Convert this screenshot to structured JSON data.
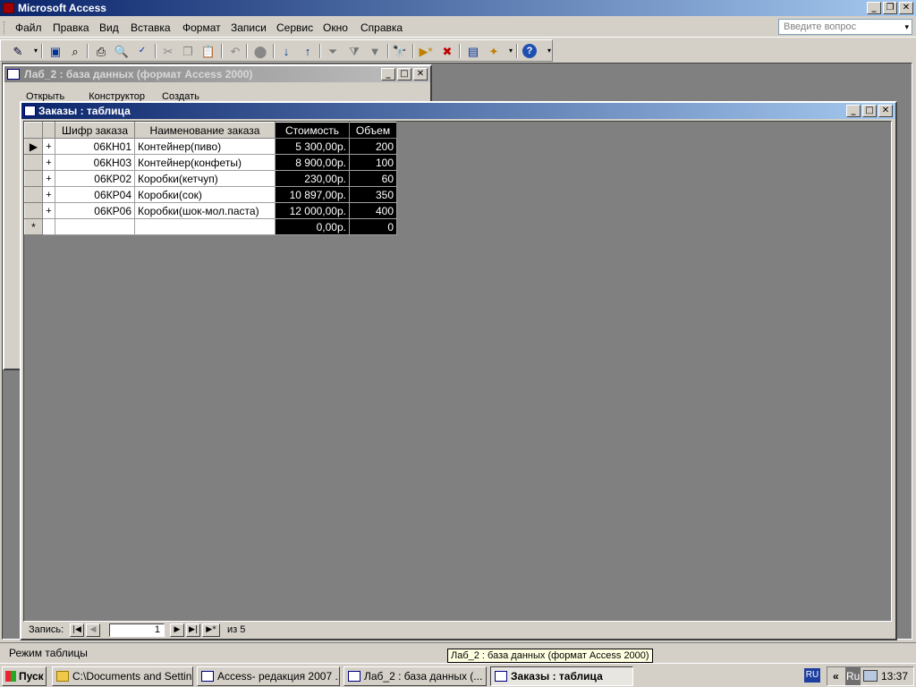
{
  "app": {
    "title": "Microsoft Access"
  },
  "menu": [
    "Файл",
    "Правка",
    "Вид",
    "Вставка",
    "Формат",
    "Записи",
    "Сервис",
    "Окно",
    "Справка"
  ],
  "ask": {
    "placeholder": "Введите вопрос"
  },
  "toolbar_icons": [
    "view-icon",
    "dropdown-arrow-icon",
    "save-icon",
    "file-search-icon",
    "print-icon",
    "print-preview-icon",
    "spelling-icon",
    "cut-icon",
    "copy-icon",
    "paste-icon",
    "undo-icon",
    "hyperlink-icon",
    "sort-ascending-icon",
    "sort-descending-icon",
    "filter-by-selection-icon",
    "filter-by-form-icon",
    "apply-filter-icon",
    "find-icon",
    "new-record-icon",
    "delete-record-icon",
    "database-window-icon",
    "new-object-icon",
    "help-icon"
  ],
  "db_window": {
    "title": "Лаб_2 : база данных (формат Access 2000)",
    "tools": [
      "Открыть",
      "Конструктор",
      "Создать"
    ]
  },
  "table_window": {
    "title": "Заказы : таблица",
    "columns": [
      "Шифр заказа",
      "Наименование заказа",
      "Стоимость",
      "Объем"
    ],
    "rows": [
      [
        "06КН01",
        "Контейнер(пиво)",
        "5 300,00р.",
        "200"
      ],
      [
        "06КН03",
        "Контейнер(конфеты)",
        "8 900,00р.",
        "100"
      ],
      [
        "06КР02",
        "Коробки(кетчуп)",
        "230,00р.",
        "60"
      ],
      [
        "06КР04",
        "Коробки(сок)",
        "10 897,00р.",
        "350"
      ],
      [
        "06КР06",
        "Коробки(шок-мол.паста)",
        "12 000,00р.",
        "400"
      ]
    ],
    "new_row": [
      "",
      "",
      "0,00р.",
      "0"
    ],
    "expand_symbol": "+",
    "new_symbol": "*"
  },
  "navigation": {
    "label": "Запись:",
    "current": "1",
    "of_label": "из 5"
  },
  "status": {
    "text": "Режим таблицы"
  },
  "tooltip": {
    "text": "Лаб_2 : база данных (формат Access 2000)"
  },
  "taskbar": {
    "start": "Пуск",
    "buttons": [
      "C:\\Documents and Settin...",
      "Access- редакция 2007 ...",
      "Лаб_2 : база данных (...",
      "Заказы : таблица"
    ],
    "lang": "RU",
    "lang2": "Ru",
    "chevron": "«",
    "clock": "13:37"
  }
}
